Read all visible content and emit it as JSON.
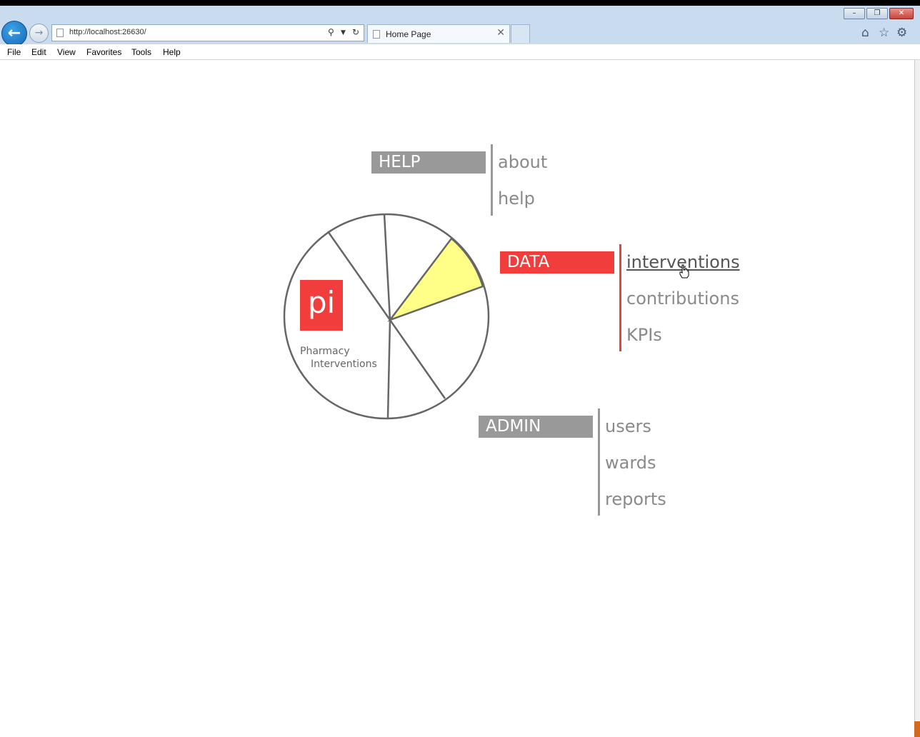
{
  "browser": {
    "address_url": "http://localhost:26630/",
    "tab_title": "Home Page",
    "menu": [
      "File",
      "Edit",
      "View",
      "Favorites",
      "Tools",
      "Help"
    ],
    "icons": [
      "back-icon",
      "forward-icon",
      "search-icon",
      "refresh-icon",
      "home-icon",
      "favorites-star-icon",
      "settings-gear-icon"
    ]
  },
  "logo": {
    "mark": "pi",
    "line1": "Pharmacy",
    "line2": "Interventions"
  },
  "sections": {
    "help": {
      "title": "HELP",
      "color": "#999999",
      "links": [
        "about",
        "help"
      ]
    },
    "data": {
      "title": "DATA",
      "color": "#f23d3d",
      "links": [
        "interventions",
        "contributions",
        "KPIs"
      ],
      "active_link": "interventions"
    },
    "admin": {
      "title": "ADMIN",
      "color": "#999999",
      "links": [
        "users",
        "wards",
        "reports"
      ]
    }
  },
  "colors": {
    "highlight_slice": "#ffff88",
    "pie_stroke": "#666666",
    "accent": "#f23d3d"
  }
}
